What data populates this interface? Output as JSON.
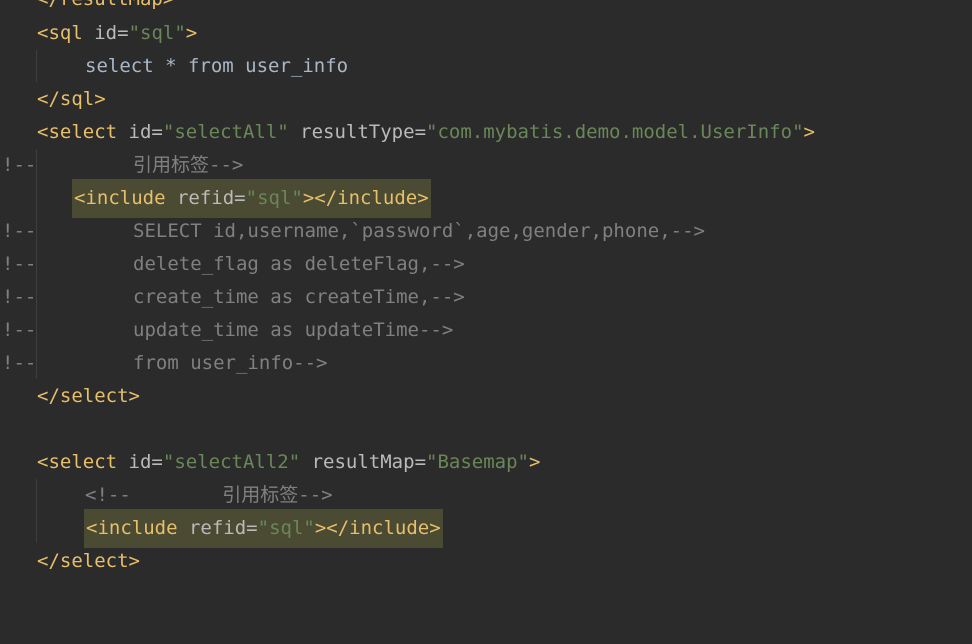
{
  "editor": {
    "line0": {
      "tag": "</resultMap>"
    },
    "line1": {
      "open": "<sql",
      "attr": "id",
      "eq": "=",
      "val": "\"sql\"",
      "close": ">"
    },
    "line2": {
      "text": "select * from user_info"
    },
    "line3": {
      "tag": "</sql>"
    },
    "line4": {
      "open": "<select",
      "attr1": "id",
      "val1": "\"selectAll\"",
      "attr2": "resultType",
      "val2": "\"com.mybatis.demo.model.UserInfo\"",
      "close": ">"
    },
    "line5": {
      "marker": "!--",
      "text": "引用标签-->"
    },
    "line6": {
      "open": "<include",
      "attr": "refid",
      "val": "\"sql\"",
      "close": "></include>"
    },
    "line7": {
      "marker": "!--",
      "text": "SELECT id,username,`password`,age,gender,phone,-->"
    },
    "line8": {
      "marker": "!--",
      "text": "delete_flag as deleteFlag,-->"
    },
    "line9": {
      "marker": "!--",
      "text": "create_time as createTime,-->"
    },
    "line10": {
      "marker": "!--",
      "text": "update_time as updateTime-->"
    },
    "line11": {
      "marker": "!--",
      "text": "from user_info-->"
    },
    "line12": {
      "tag": "</select>"
    },
    "line14": {
      "open": "<select",
      "attr1": "id",
      "val1": "\"selectAll2\"",
      "attr2": "resultMap",
      "val2": "\"Basemap\"",
      "close": ">"
    },
    "line15": {
      "text": "<!--        引用标签-->"
    },
    "line16": {
      "open": "<include",
      "attr": "refid",
      "val": "\"sql\"",
      "close": "></include>"
    },
    "line17": {
      "tag": "</select>"
    }
  },
  "colors": {
    "background": "#2b2b2b",
    "tag": "#e8bf6a",
    "attribute": "#bababa",
    "string": "#6a8759",
    "comment": "#808080",
    "text": "#a9b7c6",
    "highlight": "#4b4a32"
  }
}
